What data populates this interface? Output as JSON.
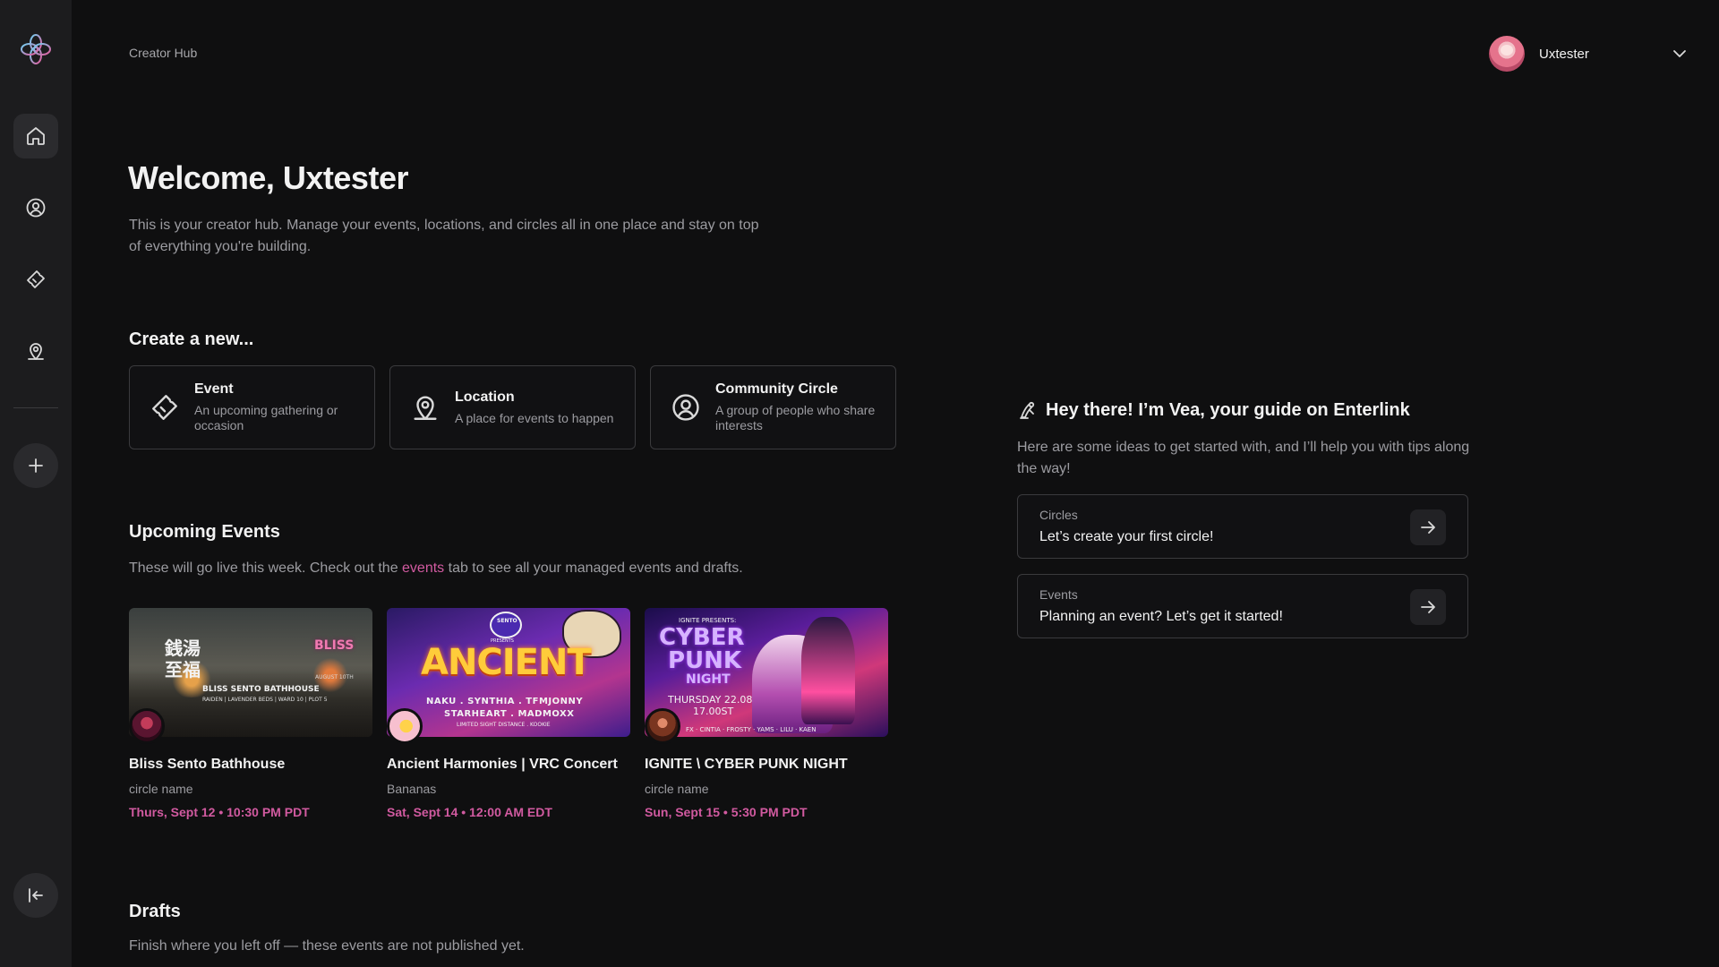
{
  "breadcrumb": "Creator Hub",
  "user": {
    "name": "Uxtester"
  },
  "welcome": {
    "title": "Welcome, Uxtester",
    "subtitle": "This is your creator hub. Manage your events, locations, and circles all in one place and stay on top of everything you're building."
  },
  "create": {
    "heading": "Create a new...",
    "cards": [
      {
        "title": "Event",
        "desc": "An upcoming gathering or occasion",
        "icon": "ticket-icon"
      },
      {
        "title": "Location",
        "desc": "A place for events to happen",
        "icon": "location-pin-icon"
      },
      {
        "title": "Community Circle",
        "desc": "A group of people who share interests",
        "icon": "person-circle-icon"
      }
    ]
  },
  "upcoming": {
    "heading": "Upcoming Events",
    "desc_before": "These will go live this week. Check out the ",
    "desc_link": "events",
    "desc_after": " tab to see all your managed events and drafts.",
    "events": [
      {
        "name": "Bliss Sento Bathhouse",
        "circle": "circle name",
        "date": "Thurs, Sept 12 • 10:30 PM PDT",
        "image_lines": [
          "銭湯",
          "至福",
          "BLISS",
          "BLISS SENTO BATHHOUSE",
          "AUGUST 10TH",
          "RAIDEN | LAVENDER BEDS | WARD 10 | PLOT 5"
        ]
      },
      {
        "name": "Ancient Harmonies | VRC Concert",
        "circle": "Bananas",
        "date": "Sat, Sept 14 • 12:00 AM EDT",
        "image_lines": [
          "ANCIENT",
          "NAKU . SYNTHIA . TFMJONNY",
          "STARHEART . MADMOXX",
          "LIMITED SIGHT DISTANCE . KOOKIE",
          "SENTO",
          "PRESENTS"
        ]
      },
      {
        "name": "IGNITE \\ CYBER PUNK NIGHT",
        "circle": "circle name",
        "date": "Sun, Sept 15 • 5:30 PM PDT",
        "image_lines": [
          "IGNITE PRESENTS:",
          "CYBER",
          "PUNK",
          "NIGHT",
          "THURSDAY 22.08",
          "17.00ST",
          "FX · CINTIA · FROSTY · YAMS · LILU · KAEN"
        ]
      }
    ]
  },
  "drafts": {
    "heading": "Drafts",
    "desc": "Finish where you left off — these events are not published yet."
  },
  "guide": {
    "title": "Hey there! I’m Vea, your guide on Enterlink",
    "desc": "Here are some ideas to get started with, and I’ll help you with tips along the way!",
    "cards": [
      {
        "label": "Circles",
        "text": "Let’s create your first circle!"
      },
      {
        "label": "Events",
        "text": "Planning an event? Let’s get it started!"
      }
    ]
  },
  "colors": {
    "accent": "#d15aa0",
    "background": "#0f0f10",
    "sidebar": "#1c1c1e"
  }
}
